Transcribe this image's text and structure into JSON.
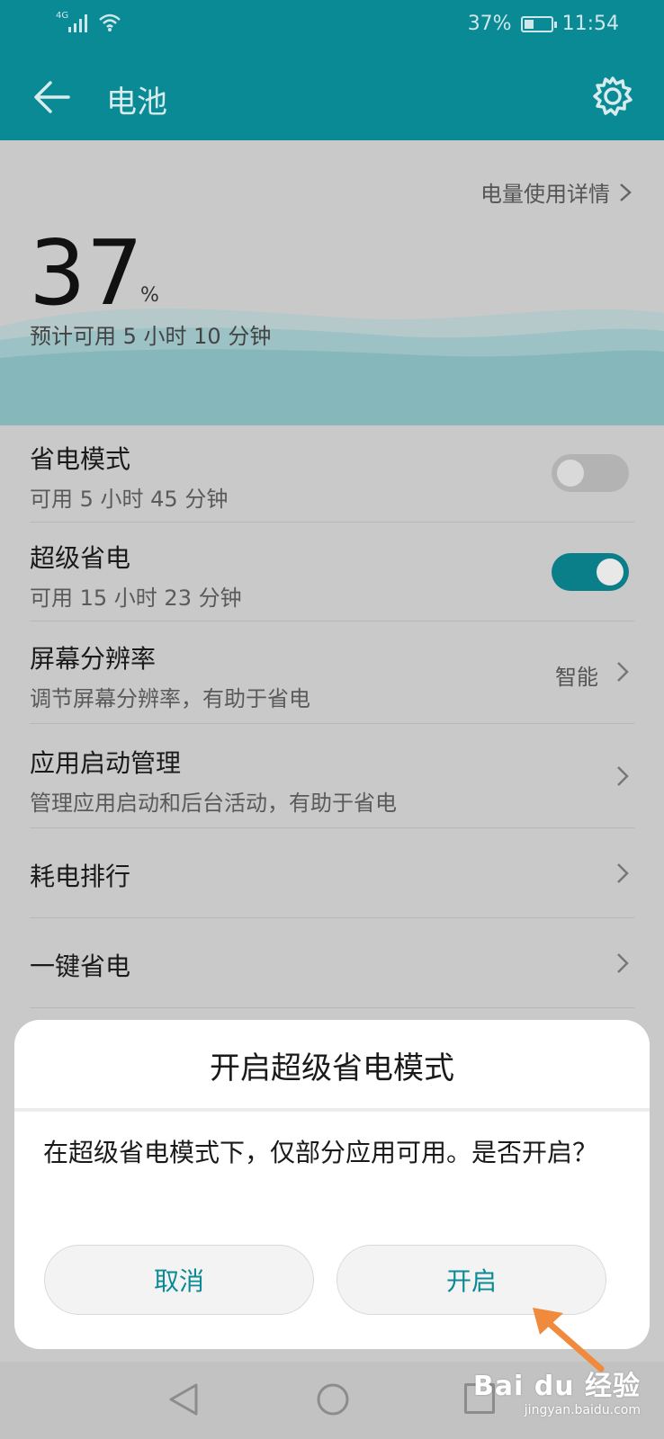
{
  "status_bar": {
    "signal_label": "4G",
    "battery_percent": "37%",
    "battery_level": 0.37,
    "time": "11:54"
  },
  "app_bar": {
    "title": "电池",
    "back_icon": "back-arrow-icon",
    "settings_icon": "gear-icon"
  },
  "hero": {
    "details_link": "电量使用详情",
    "battery_value": "37",
    "percent_sign": "%",
    "estimate": "预计可用 5 小时 10 分钟"
  },
  "rows": {
    "power_saving": {
      "title": "省电模式",
      "subtitle": "可用 5 小时 45 分钟",
      "enabled": false
    },
    "ultra_saving": {
      "title": "超级省电",
      "subtitle": "可用 15 小时 23 分钟",
      "enabled": true
    },
    "resolution": {
      "title": "屏幕分辨率",
      "subtitle": "调节屏幕分辨率，有助于省电",
      "value": "智能"
    },
    "app_launch": {
      "title": "应用启动管理",
      "subtitle": "管理应用启动和后台活动，有助于省电"
    },
    "power_ranking": {
      "title": "耗电排行"
    },
    "one_click": {
      "title": "一键省电"
    }
  },
  "dialog": {
    "title": "开启超级省电模式",
    "message": "在超级省电模式下，仅部分应用可用。是否开启？",
    "cancel_label": "取消",
    "confirm_label": "开启"
  },
  "navigation": {
    "back_icon": "triangle-back-icon",
    "home_icon": "circle-home-icon",
    "recent_icon": "square-recent-icon"
  },
  "watermark": {
    "logo": "Bai du 经验",
    "url": "jingyan.baidu.com"
  },
  "colors": {
    "accent": "#0a8a95",
    "dim_background": "#c9c9c9",
    "annotation_arrow": "#f08a3c"
  }
}
